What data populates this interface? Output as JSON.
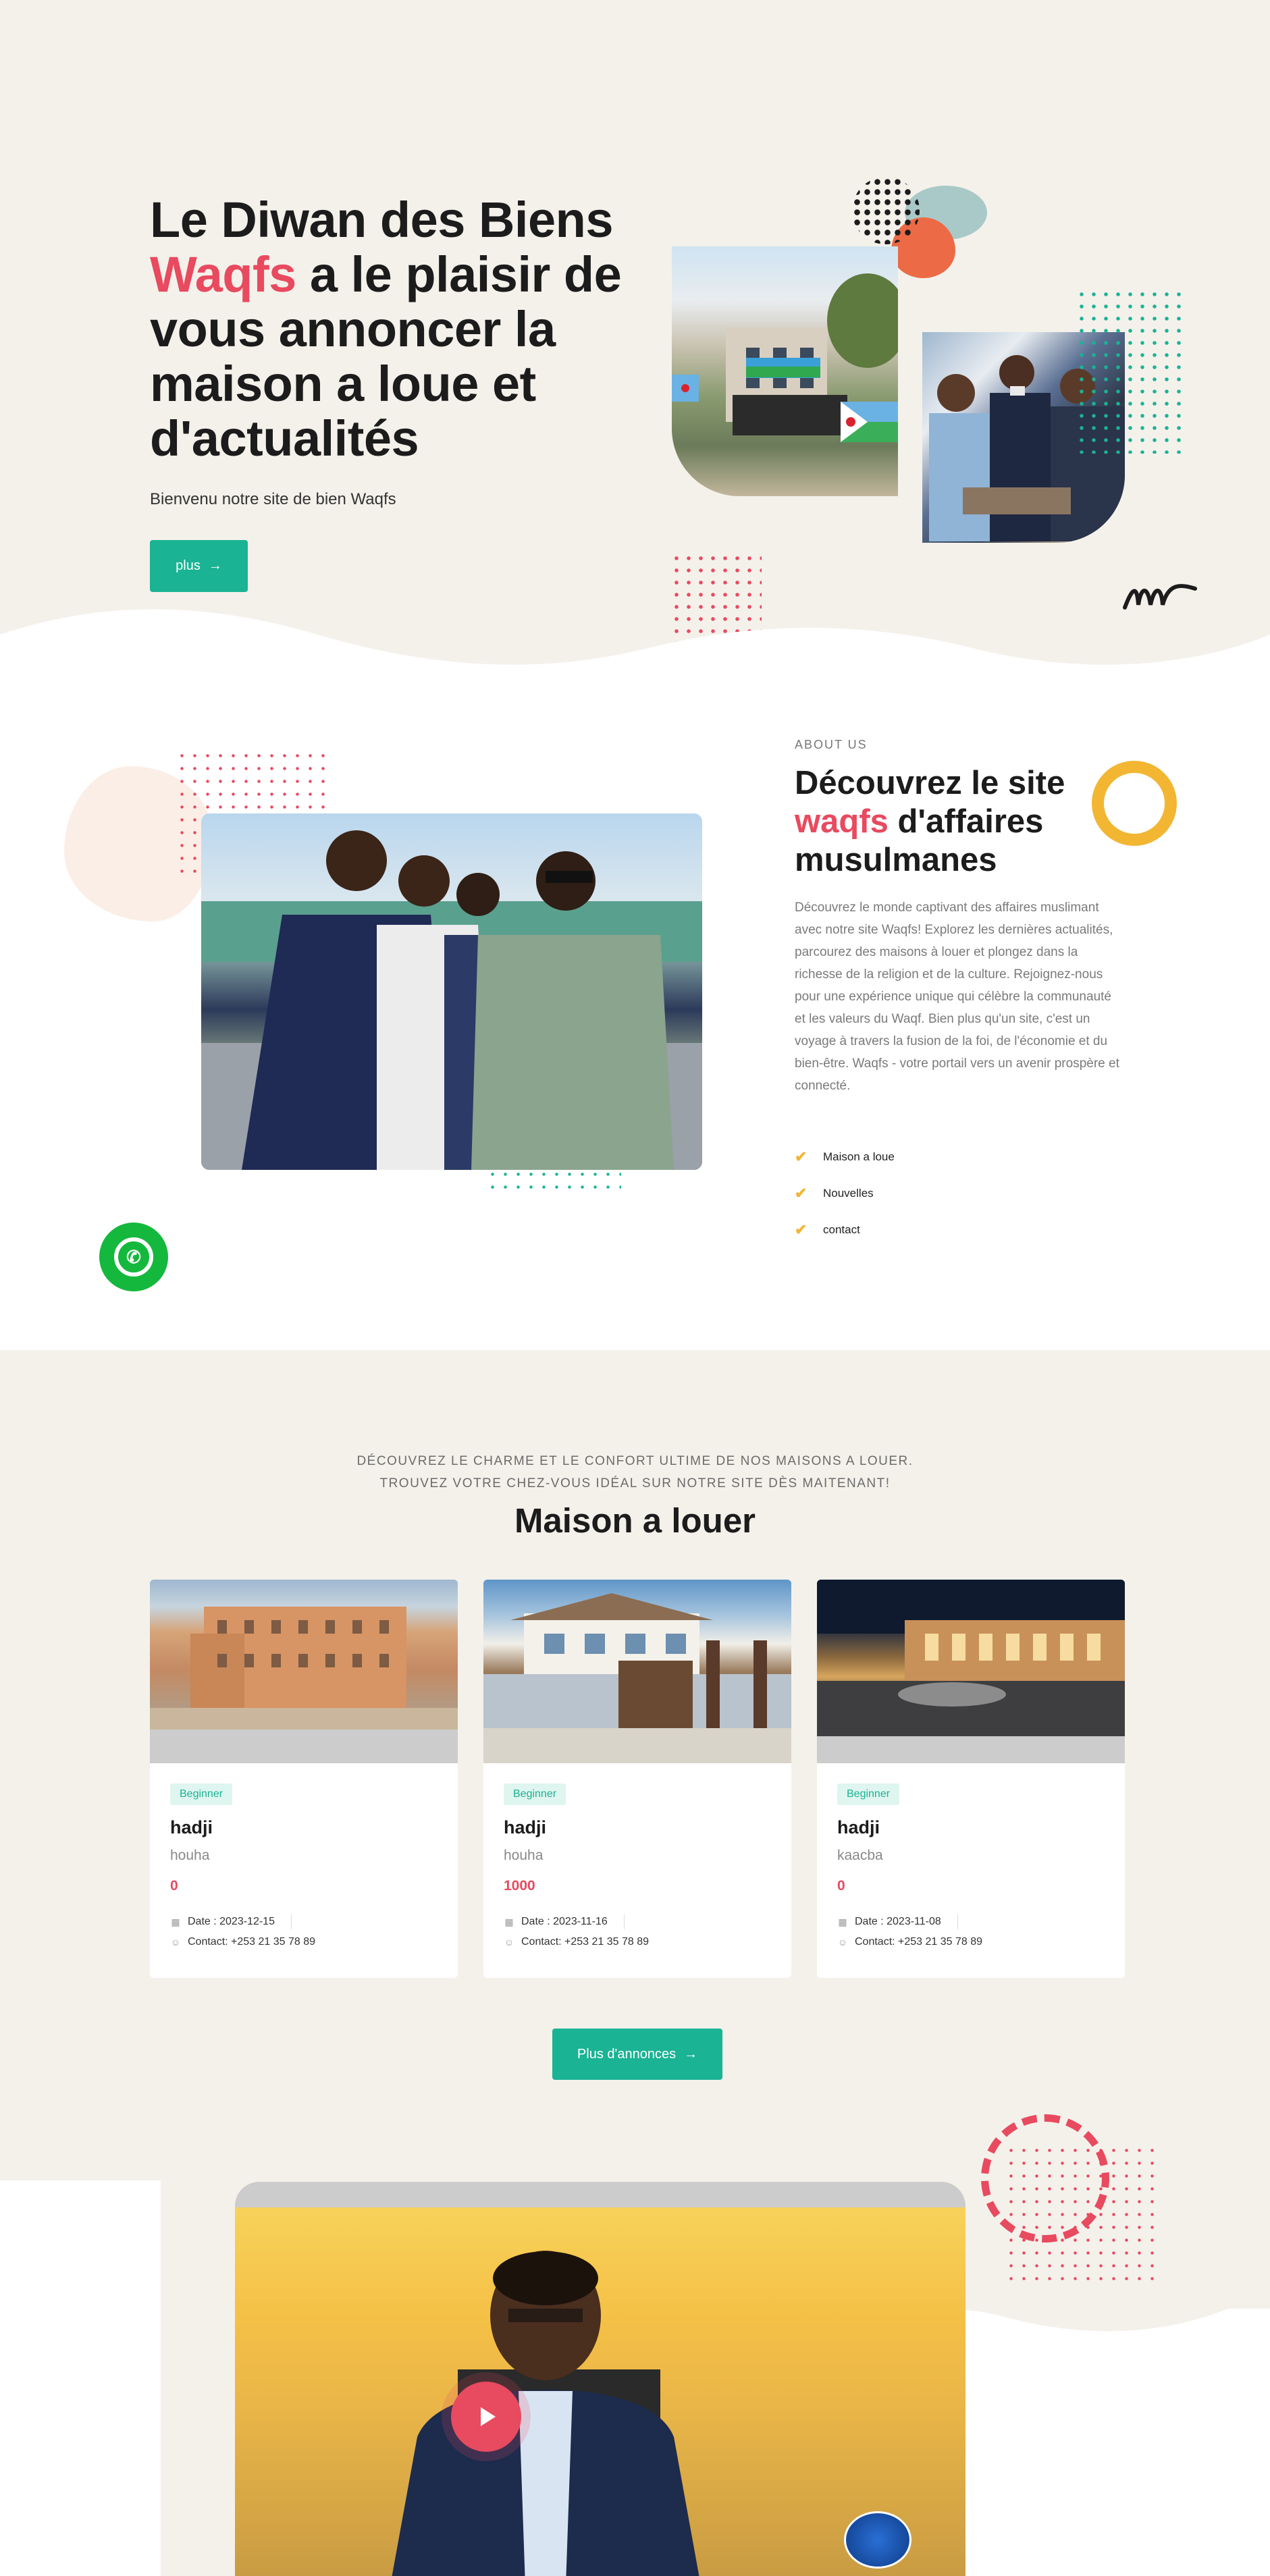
{
  "hero": {
    "title_part1": "Le Diwan des Biens",
    "title_accent": "Waqfs",
    "title_part2": " a le plaisir de vous annoncer la maison a loue et d'actualités",
    "subtitle": "Bienvenu notre site de bien Waqfs",
    "button_label": "plus",
    "button_arrow": "→"
  },
  "about": {
    "eyebrow": "ABOUT US",
    "title_part1": "Découvrez le site",
    "title_accent": "waqfs",
    "title_part2": " d'affaires musulmanes",
    "body": "Découvrez le monde captivant des affaires muslimant avec notre site Waqfs! Explorez les dernières actualités, parcourez des maisons à louer et plongez dans la richesse de la religion et de la culture. Rejoignez-nous pour une expérience unique qui célèbre la communauté et les valeurs du Waqf. Bien plus qu'un site, c'est un voyage à travers la fusion de la foi, de l'économie et du bien-être. Waqfs - votre portail vers un avenir prospère et connecté.",
    "checklist": [
      "Maison a loue",
      "Nouvelles",
      "contact"
    ],
    "check_icon": "✔",
    "whatsapp_icon": "whatsapp-icon"
  },
  "listings": {
    "eyebrow_line1": "DÉCOUVREZ LE CHARME ET LE CONFORT ULTIME DE NOS MAISONS A LOUER.",
    "eyebrow_line2": "TROUVEZ VOTRE CHEZ-VOUS IDÉAL SUR NOTRE SITE DÈS MAITENANT!",
    "title": "Maison a louer",
    "cards": [
      {
        "badge": "Beginner",
        "title": "hadji",
        "subtitle": "houha",
        "price": "0",
        "date": "Date : 2023-12-15",
        "contact": "Contact: +253 21 35 78 89"
      },
      {
        "badge": "Beginner",
        "title": "hadji",
        "subtitle": "houha",
        "price": "1000",
        "date": "Date : 2023-11-16",
        "contact": "Contact: +253 21 35 78 89"
      },
      {
        "badge": "Beginner",
        "title": "hadji",
        "subtitle": "kaacba",
        "price": "0",
        "date": "Date : 2023-11-08",
        "contact": "Contact: +253 21 35 78 89"
      }
    ],
    "more_button": "Plus d'annonces",
    "more_arrow": "→"
  },
  "video": {
    "play_icon": "play-icon"
  },
  "colors": {
    "accent_red": "#e84a5f",
    "brand_green": "#1ab394",
    "yellow": "#f2b632",
    "cream": "#f4f1eb"
  }
}
